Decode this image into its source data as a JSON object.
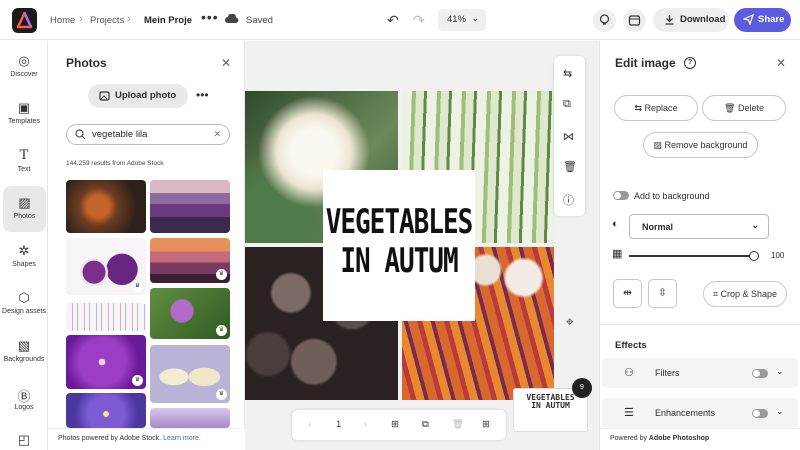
{
  "colors": {
    "accent": "#5c5ce0",
    "logo_bg": "#1b1b1b",
    "link": "#2a6ad1"
  },
  "header": {
    "breadcrumbs": [
      "Home",
      "Projects",
      "Mein Proje"
    ],
    "save_status": "Saved",
    "zoom": "41%",
    "download_label": "Download",
    "share_label": "Share"
  },
  "rail": {
    "items": [
      {
        "label": "Discover",
        "icon": "compass-icon"
      },
      {
        "label": "Templates",
        "icon": "templates-icon"
      },
      {
        "label": "Text",
        "icon": "text-icon"
      },
      {
        "label": "Photos",
        "icon": "photos-icon",
        "active": true
      },
      {
        "label": "Shapes",
        "icon": "shapes-icon"
      },
      {
        "label": "Design assets",
        "icon": "design-assets-icon"
      },
      {
        "label": "Backgrounds",
        "icon": "backgrounds-icon"
      },
      {
        "label": "Logos",
        "icon": "logos-icon"
      }
    ]
  },
  "photos_panel": {
    "title": "Photos",
    "upload_label": "Upload photo",
    "search_value": "vegetable lila",
    "results_count": "144,259 results from Adobe Stock",
    "footer_text": "Photos powered by Adobe Stock.",
    "footer_link": "Learn more."
  },
  "canvas": {
    "title_text": "VEGETABLES\nIN AUTUM",
    "thumb_text": "VEGETABLES\nIN AUTUM",
    "page_number": "1",
    "page_count_badge": "9"
  },
  "edit_panel": {
    "title": "Edit image",
    "replace_label": "Replace",
    "delete_label": "Delete",
    "remove_bg_label": "Remove background",
    "add_to_bg_label": "Add to background",
    "blend_mode": "Normal",
    "opacity_value": "100",
    "crop_label": "Crop & Shape",
    "effects_heading": "Effects",
    "filters_label": "Filters",
    "enhancements_label": "Enhancements",
    "footer_prefix": "Powered by",
    "footer_brand": "Adobe Photoshop"
  }
}
